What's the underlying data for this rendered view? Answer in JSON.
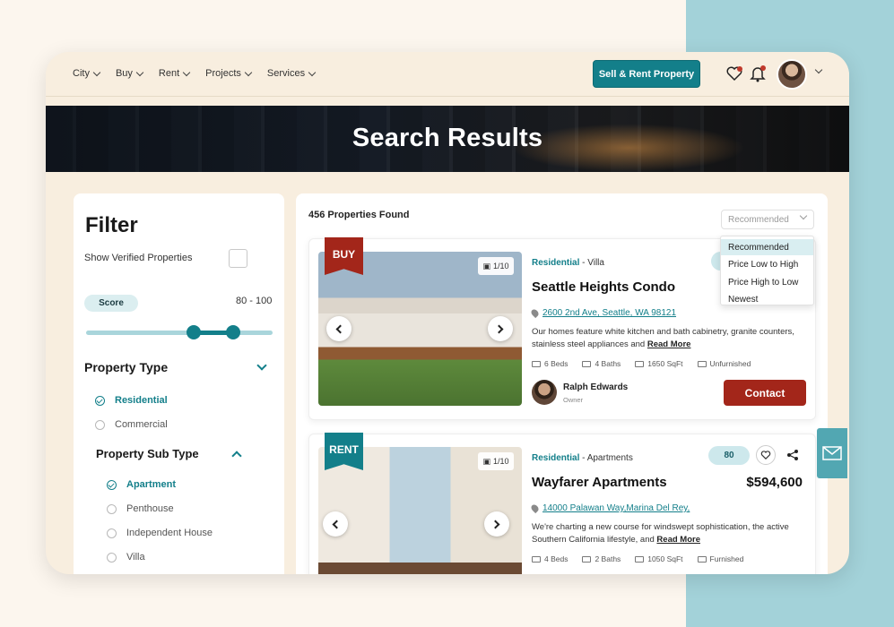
{
  "nav": {
    "items": [
      {
        "label": "City"
      },
      {
        "label": "Buy"
      },
      {
        "label": "Rent"
      },
      {
        "label": "Projects"
      },
      {
        "label": "Services"
      }
    ],
    "cta_label": "Sell & Rent Property",
    "icons": [
      "heart-icon",
      "bell-icon",
      "avatar",
      "chevron-down-icon"
    ]
  },
  "hero": {
    "title": "Search Results"
  },
  "filter": {
    "title": "Filter",
    "verified_label": "Show Verified Properties",
    "score_label": "Score",
    "score_range": "80 - 100",
    "score_min": 80,
    "score_max": 100,
    "property_type": {
      "title": "Property Type",
      "options": [
        {
          "label": "Residential",
          "selected": true
        },
        {
          "label": "Commercial",
          "selected": false
        }
      ]
    },
    "property_sub_type": {
      "title": "Property Sub Type",
      "options": [
        {
          "label": "Apartment",
          "selected": true
        },
        {
          "label": "Penthouse",
          "selected": false
        },
        {
          "label": "Independent House",
          "selected": false
        },
        {
          "label": "Villa",
          "selected": false
        }
      ]
    }
  },
  "results": {
    "count_label": "456 Properties Found",
    "sort_placeholder": "Recommended",
    "sort_options": [
      "Recommended",
      "Price Low to High",
      "Price High to Low",
      "Newest"
    ],
    "sort_selected": "Recommended",
    "cards": [
      {
        "ribbon": "BUY",
        "image_count": "1/10",
        "category": "Residential",
        "subtype": " - Villa",
        "title": "Seattle Heights Condo",
        "address": "2600 2nd Ave, Seattle, WA 98121",
        "description": "Our homes feature white kitchen and bath cabinetry, granite counters, stainless steel appliances and ",
        "read_more": "Read More",
        "beds": "6 Beds",
        "baths": "4 Baths",
        "area": "1650 SqFt",
        "furnishing": "Unfurnished",
        "owner_name": "Ralph Edwards",
        "owner_role": "Owner",
        "contact_label": "Contact"
      },
      {
        "ribbon": "RENT",
        "image_count": "1/10",
        "category": "Residential",
        "subtype": " - Apartments",
        "score": "80",
        "title": "Wayfarer Apartments",
        "price": "$594,600",
        "address": "14000 Palawan Way,Marina Del Rey,",
        "description": "We're charting a new course for windswept sophistication, the active Southern California lifestyle, and ",
        "read_more": "Read More",
        "beds": "4 Beds",
        "baths": "2 Baths",
        "area": "1050 SqFt",
        "furnishing": "Furnished"
      }
    ]
  },
  "colors": {
    "accent": "#137f8a",
    "brand_red": "#a3261a",
    "background": "#f8eedf"
  }
}
